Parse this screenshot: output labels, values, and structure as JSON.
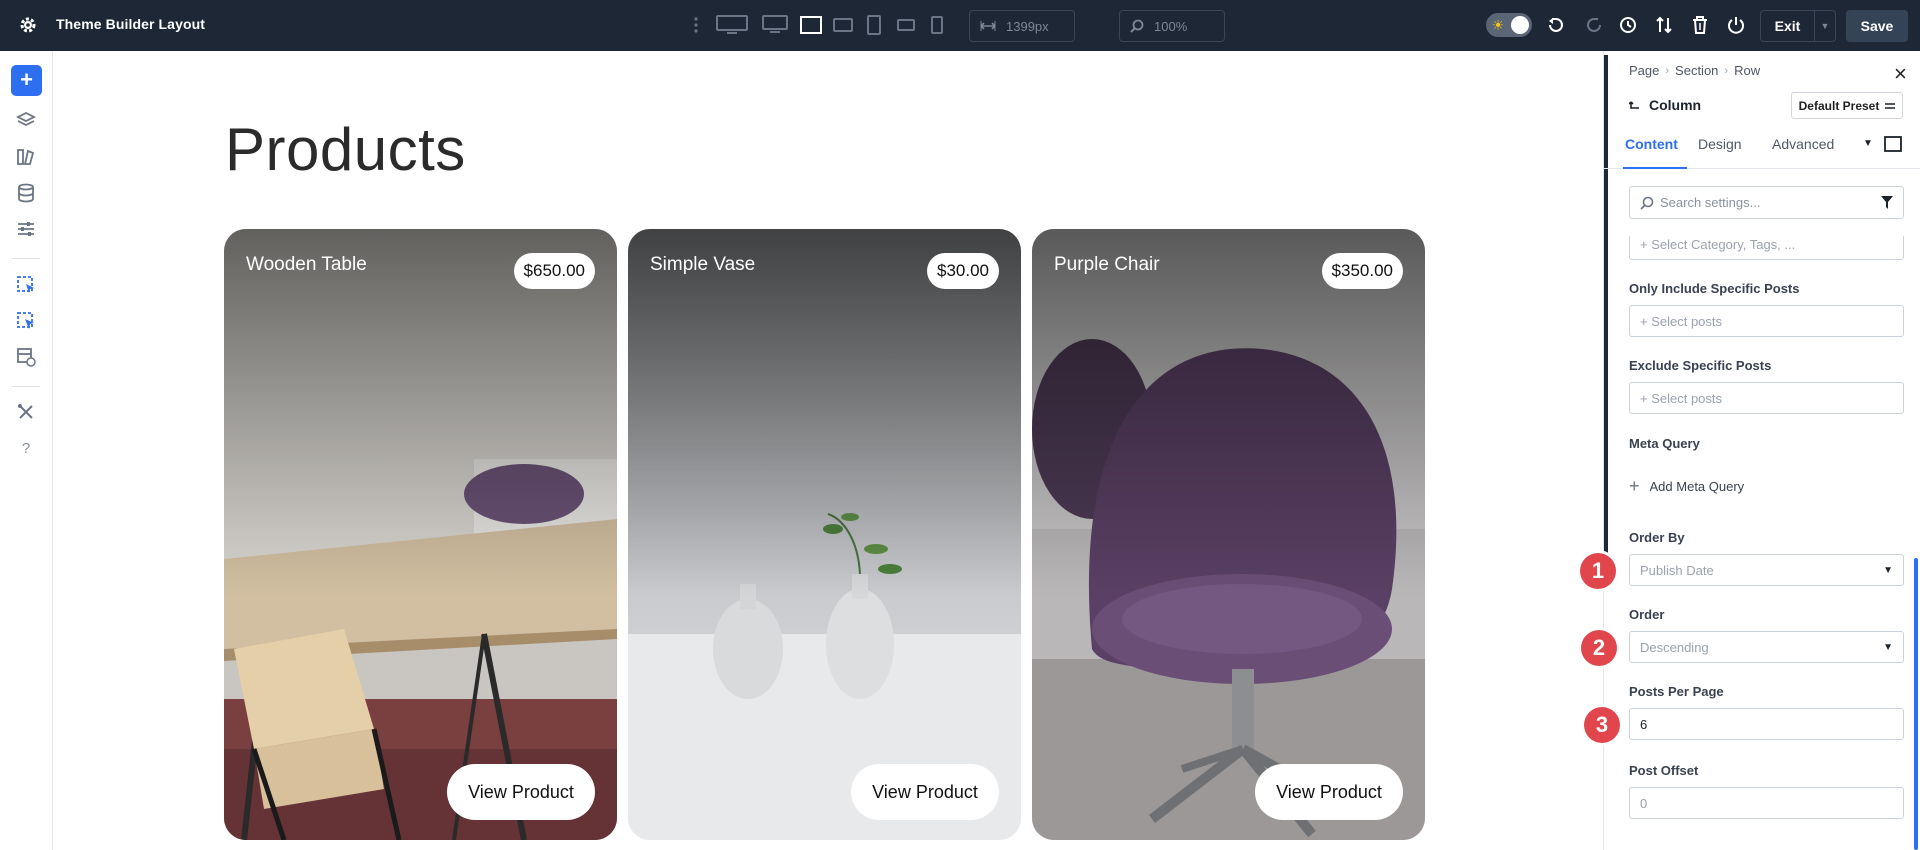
{
  "app": {
    "title": "Theme Builder Layout"
  },
  "toolbar": {
    "width_value": "1399px",
    "zoom_value": "100%",
    "exit_label": "Exit",
    "save_label": "Save"
  },
  "canvas": {
    "heading": "Products",
    "products": [
      {
        "name": "Wooden Table",
        "price": "$650.00",
        "button": "View Product"
      },
      {
        "name": "Simple Vase",
        "price": "$30.00",
        "button": "View Product"
      },
      {
        "name": "Purple Chair",
        "price": "$350.00",
        "button": "View Product"
      }
    ]
  },
  "panel": {
    "breadcrumb": [
      "Page",
      "Section",
      "Row"
    ],
    "title": "Column",
    "preset": "Default Preset",
    "tabs": [
      "Content",
      "Design",
      "Advanced"
    ],
    "active_tab": "Content",
    "search_placeholder": "Search settings...",
    "fields": {
      "category_placeholder": "+ Select Category, Tags, ...",
      "include_label": "Only Include Specific Posts",
      "include_placeholder": "+ Select posts",
      "exclude_label": "Exclude Specific Posts",
      "exclude_placeholder": "+ Select posts",
      "meta_label": "Meta Query",
      "add_meta": "Add Meta Query",
      "order_by_label": "Order By",
      "order_by_value": "Publish Date",
      "order_label": "Order",
      "order_value": "Descending",
      "ppp_label": "Posts Per Page",
      "ppp_value": "6",
      "offset_label": "Post Offset",
      "offset_placeholder": "0"
    },
    "badges": [
      "1",
      "2",
      "3"
    ]
  },
  "colors": {
    "accent": "#2e6ff2",
    "topbar": "#1d2735",
    "badge": "#e0464c"
  }
}
